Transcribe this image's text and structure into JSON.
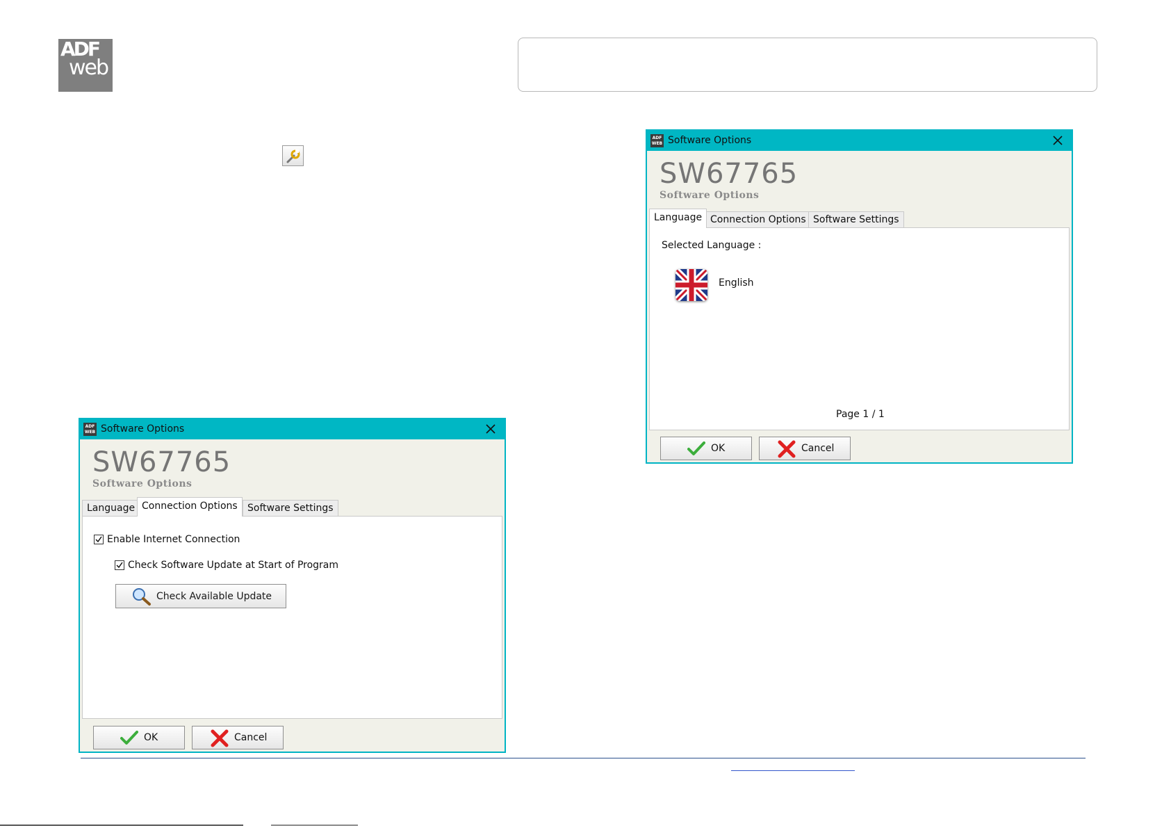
{
  "logo": {
    "line1": "ADF",
    "line2": "web"
  },
  "dialog_connection": {
    "window_title": "Software Options",
    "code": "SW67765",
    "subtitle": "Software Options",
    "tabs": [
      "Language",
      "Connection Options",
      "Software Settings"
    ],
    "active_tab": "Connection Options",
    "enable_internet_label": "Enable Internet Connection",
    "enable_internet_checked": true,
    "check_update_label": "Check Software Update at Start of Program",
    "check_update_checked": true,
    "check_available_button": "Check Available Update",
    "ok_label": "OK",
    "cancel_label": "Cancel"
  },
  "dialog_language": {
    "window_title": "Software Options",
    "code": "SW67765",
    "subtitle": "Software Options",
    "tabs": [
      "Language",
      "Connection Options",
      "Software Settings"
    ],
    "active_tab": "Language",
    "selected_language_label": "Selected Language :",
    "language_name": "English",
    "page_indicator": "Page 1 / 1",
    "ok_label": "OK",
    "cancel_label": "Cancel"
  },
  "icons": {
    "settings": "wrench-settings-icon",
    "flag": "uk-flag-icon",
    "ok": "green-check-icon",
    "cancel": "red-x-icon",
    "search": "magnifier-icon",
    "close": "close-icon"
  },
  "colors": {
    "titlebar": "#00b7c4",
    "dialog_bg": "#f1f1e9",
    "logo_bg": "#7f7f7f"
  }
}
